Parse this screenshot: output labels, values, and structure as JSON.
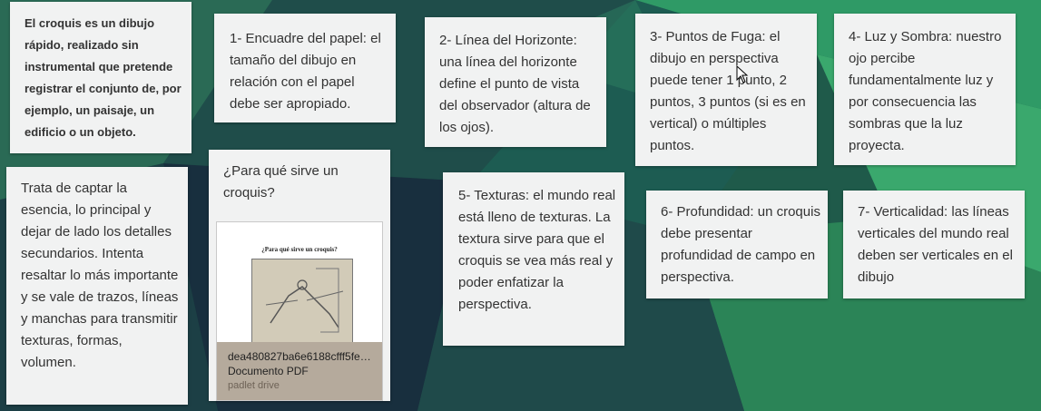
{
  "cards": {
    "intro": "El croquis es un dibujo rápido, realizado sin instrumental que pretende registrar el conjunto de, por ejemplo, un paisaje, un edificio o un objeto.",
    "essence": "Trata de captar la esencia, lo principal y dejar de lado los detalles secundarios. Intenta resaltar lo más importante y se vale de trazos, líneas y manchas para transmitir texturas, formas, volumen.",
    "p1": "1- Encuadre del papel: el tamaño del dibujo en relación con el papel debe ser apropiado.",
    "p2": "2- Línea del Horizonte: una línea del horizonte define el punto de vista del observador (altura de los ojos).",
    "p3": "3- Puntos de Fuga: el dibujo en perspectiva puede tener 1 punto, 2 puntos, 3 puntos (si es en vertical) o múltiples puntos.",
    "p4": "4- Luz y Sombra: nuestro ojo percibe fundamentalmente luz y por consecuencia las sombras que la luz proyecta.",
    "p5": "5- Texturas: el mundo real está lleno de texturas. La textura sirve para que el croquis se vea  más real y poder enfatizar la perspectiva.",
    "p6": "6- Profundidad: un croquis debe presentar profundidad de campo en perspectiva.",
    "p7": "7- Verticalidad: las líneas verticales del mundo real deben ser verticales en el dibujo"
  },
  "attachment_card": {
    "title": "¿Para qué sirve un croquis?",
    "preview_title": "¿Para qué sirve un croquis?",
    "file_name": "dea480827ba6e6188cfff5fe28...",
    "file_type": "Documento PDF",
    "source": "padlet drive"
  },
  "colors": {
    "background": "#1f5a4a",
    "card": "#f1f2f2",
    "attachment_bar": "#b5aa9c"
  },
  "icons": [
    "mouse-cursor-icon",
    "pdf-sketch-thumbnail"
  ]
}
